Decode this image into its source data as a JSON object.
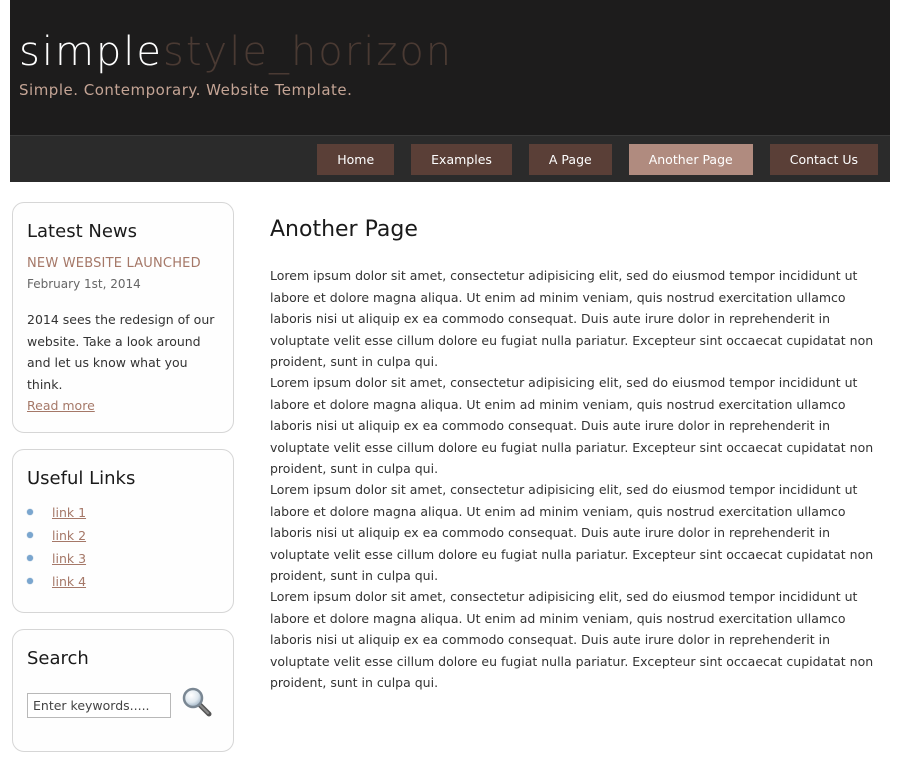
{
  "header": {
    "logo_part1": "simple",
    "logo_part2": "style_horizon",
    "slogan": "Simple. Contemporary. Website Template."
  },
  "menu": {
    "items": [
      {
        "label": "Home",
        "selected": false
      },
      {
        "label": "Examples",
        "selected": false
      },
      {
        "label": "A Page",
        "selected": false
      },
      {
        "label": "Another Page",
        "selected": true
      },
      {
        "label": "Contact Us",
        "selected": false
      }
    ]
  },
  "sidebar": {
    "news": {
      "heading": "Latest News",
      "title": "NEW WEBSITE LAUNCHED",
      "date": "February 1st, 2014",
      "body": "2014 sees the redesign of our website. Take a look around and let us know what you think.",
      "read_more": "Read more"
    },
    "links": {
      "heading": "Useful Links",
      "items": [
        "link 1",
        "link 2",
        "link 3",
        "link 4"
      ]
    },
    "search": {
      "heading": "Search",
      "placeholder": "Enter keywords....."
    }
  },
  "content": {
    "title": "Another Page",
    "paragraphs": [
      "Lorem ipsum dolor sit amet, consectetur adipisicing elit, sed do eiusmod tempor incididunt ut labore et dolore magna aliqua. Ut enim ad minim veniam, quis nostrud exercitation ullamco laboris nisi ut aliquip ex ea commodo consequat. Duis aute irure dolor in reprehenderit in voluptate velit esse cillum dolore eu fugiat nulla pariatur. Excepteur sint occaecat cupidatat non proident, sunt in culpa qui.",
      "Lorem ipsum dolor sit amet, consectetur adipisicing elit, sed do eiusmod tempor incididunt ut labore et dolore magna aliqua. Ut enim ad minim veniam, quis nostrud exercitation ullamco laboris nisi ut aliquip ex ea commodo consequat. Duis aute irure dolor in reprehenderit in voluptate velit esse cillum dolore eu fugiat nulla pariatur. Excepteur sint occaecat cupidatat non proident, sunt in culpa qui.",
      "Lorem ipsum dolor sit amet, consectetur adipisicing elit, sed do eiusmod tempor incididunt ut labore et dolore magna aliqua. Ut enim ad minim veniam, quis nostrud exercitation ullamco laboris nisi ut aliquip ex ea commodo consequat. Duis aute irure dolor in reprehenderit in voluptate velit esse cillum dolore eu fugiat nulla pariatur. Excepteur sint occaecat cupidatat non proident, sunt in culpa qui.",
      "Lorem ipsum dolor sit amet, consectetur adipisicing elit, sed do eiusmod tempor incididunt ut labore et dolore magna aliqua. Ut enim ad minim veniam, quis nostrud exercitation ullamco laboris nisi ut aliquip ex ea commodo consequat. Duis aute irure dolor in reprehenderit in voluptate velit esse cillum dolore eu fugiat nulla pariatur. Excepteur sint occaecat cupidatat non proident, sunt in culpa qui."
    ]
  },
  "icons": {
    "search_button": "magnifying-glass-icon",
    "link_bullet": "bullet-dot-icon"
  },
  "colors": {
    "header_bg": "#1d1c1c",
    "menubar_bg": "#2b2b2b",
    "menu_item_bg": "#5a3f37",
    "menu_item_selected_bg": "#b08b7f",
    "accent": "#a57868",
    "logo_secondary": "#4a3a33"
  }
}
